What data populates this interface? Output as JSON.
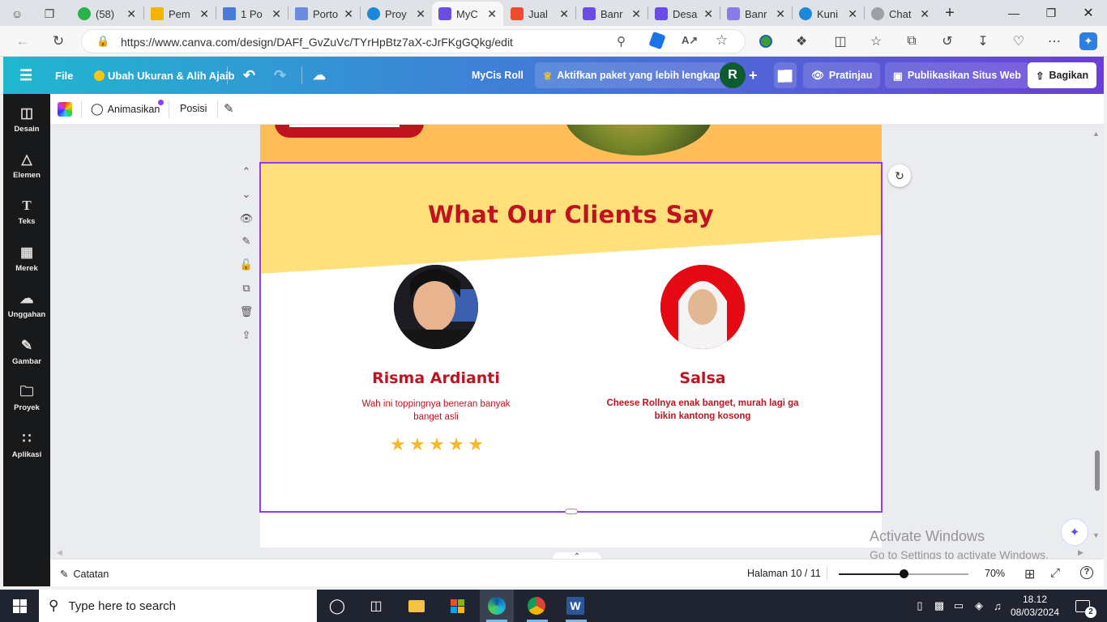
{
  "browser": {
    "tabs": [
      {
        "label": "(58)",
        "color": "#2bb24c"
      },
      {
        "label": "Pem",
        "color": "#f4b400"
      },
      {
        "label": "1 Po",
        "color": "#4a7bd9"
      },
      {
        "label": "Porto",
        "color": "#6d8be0"
      },
      {
        "label": "Proy",
        "color": "#1b88d9"
      },
      {
        "label": "MyC",
        "color": "#6b4de6"
      },
      {
        "label": "Jual",
        "color": "#ee4d2d"
      },
      {
        "label": "Banr",
        "color": "#6b4de6"
      },
      {
        "label": "Desa",
        "color": "#6b4de6"
      },
      {
        "label": "Banr",
        "color": "#8b7be8"
      },
      {
        "label": "Kuni",
        "color": "#1b88d9"
      },
      {
        "label": "Chat",
        "color": "#9aa0a6"
      }
    ],
    "url": "https://www.canva.com/design/DAFf_GvZuVc/TYrHpBtz7aX-cJrFKgGQkg/edit"
  },
  "canva_header": {
    "file": "File",
    "resize": "Ubah Ukuran & Alih Ajaib",
    "doc_title": "MyCis Roll",
    "upgrade": "Aktifkan paket yang lebih lengkap",
    "avatar_letter": "R",
    "preview": "Pratinjau",
    "publish": "Publikasikan Situs Web",
    "share": "Bagikan"
  },
  "sidebar": {
    "items": [
      "Desain",
      "Elemen",
      "Teks",
      "Merek",
      "Unggahan",
      "Gambar",
      "Proyek",
      "Aplikasi"
    ]
  },
  "toolbar": {
    "animate": "Animasikan",
    "position": "Posisi"
  },
  "page": {
    "heading": "What Our Clients Say",
    "testimonials": [
      {
        "name": "Risma Ardianti",
        "quote": "Wah ini toppingnya beneran banyak banget asli",
        "stars": 5
      },
      {
        "name": "Salsa",
        "quote": "Cheese Rollnya enak banget, murah lagi ga bikin kantong kosong"
      }
    ],
    "colors": {
      "heading": "#c1121f",
      "band": "#ffe07a",
      "top_band": "#ffbd57",
      "frame": "#8b3dff"
    }
  },
  "status": {
    "notes": "Catatan",
    "page_indicator": "Halaman 10 / 11",
    "zoom": "70%",
    "zoom_fraction": 0.5
  },
  "watermark": {
    "title": "Activate Windows",
    "subtitle": "Go to Settings to activate Windows."
  },
  "taskbar": {
    "search_placeholder": "Type here to search",
    "time": "18.12",
    "date": "08/03/2024",
    "notification_count": "2"
  }
}
